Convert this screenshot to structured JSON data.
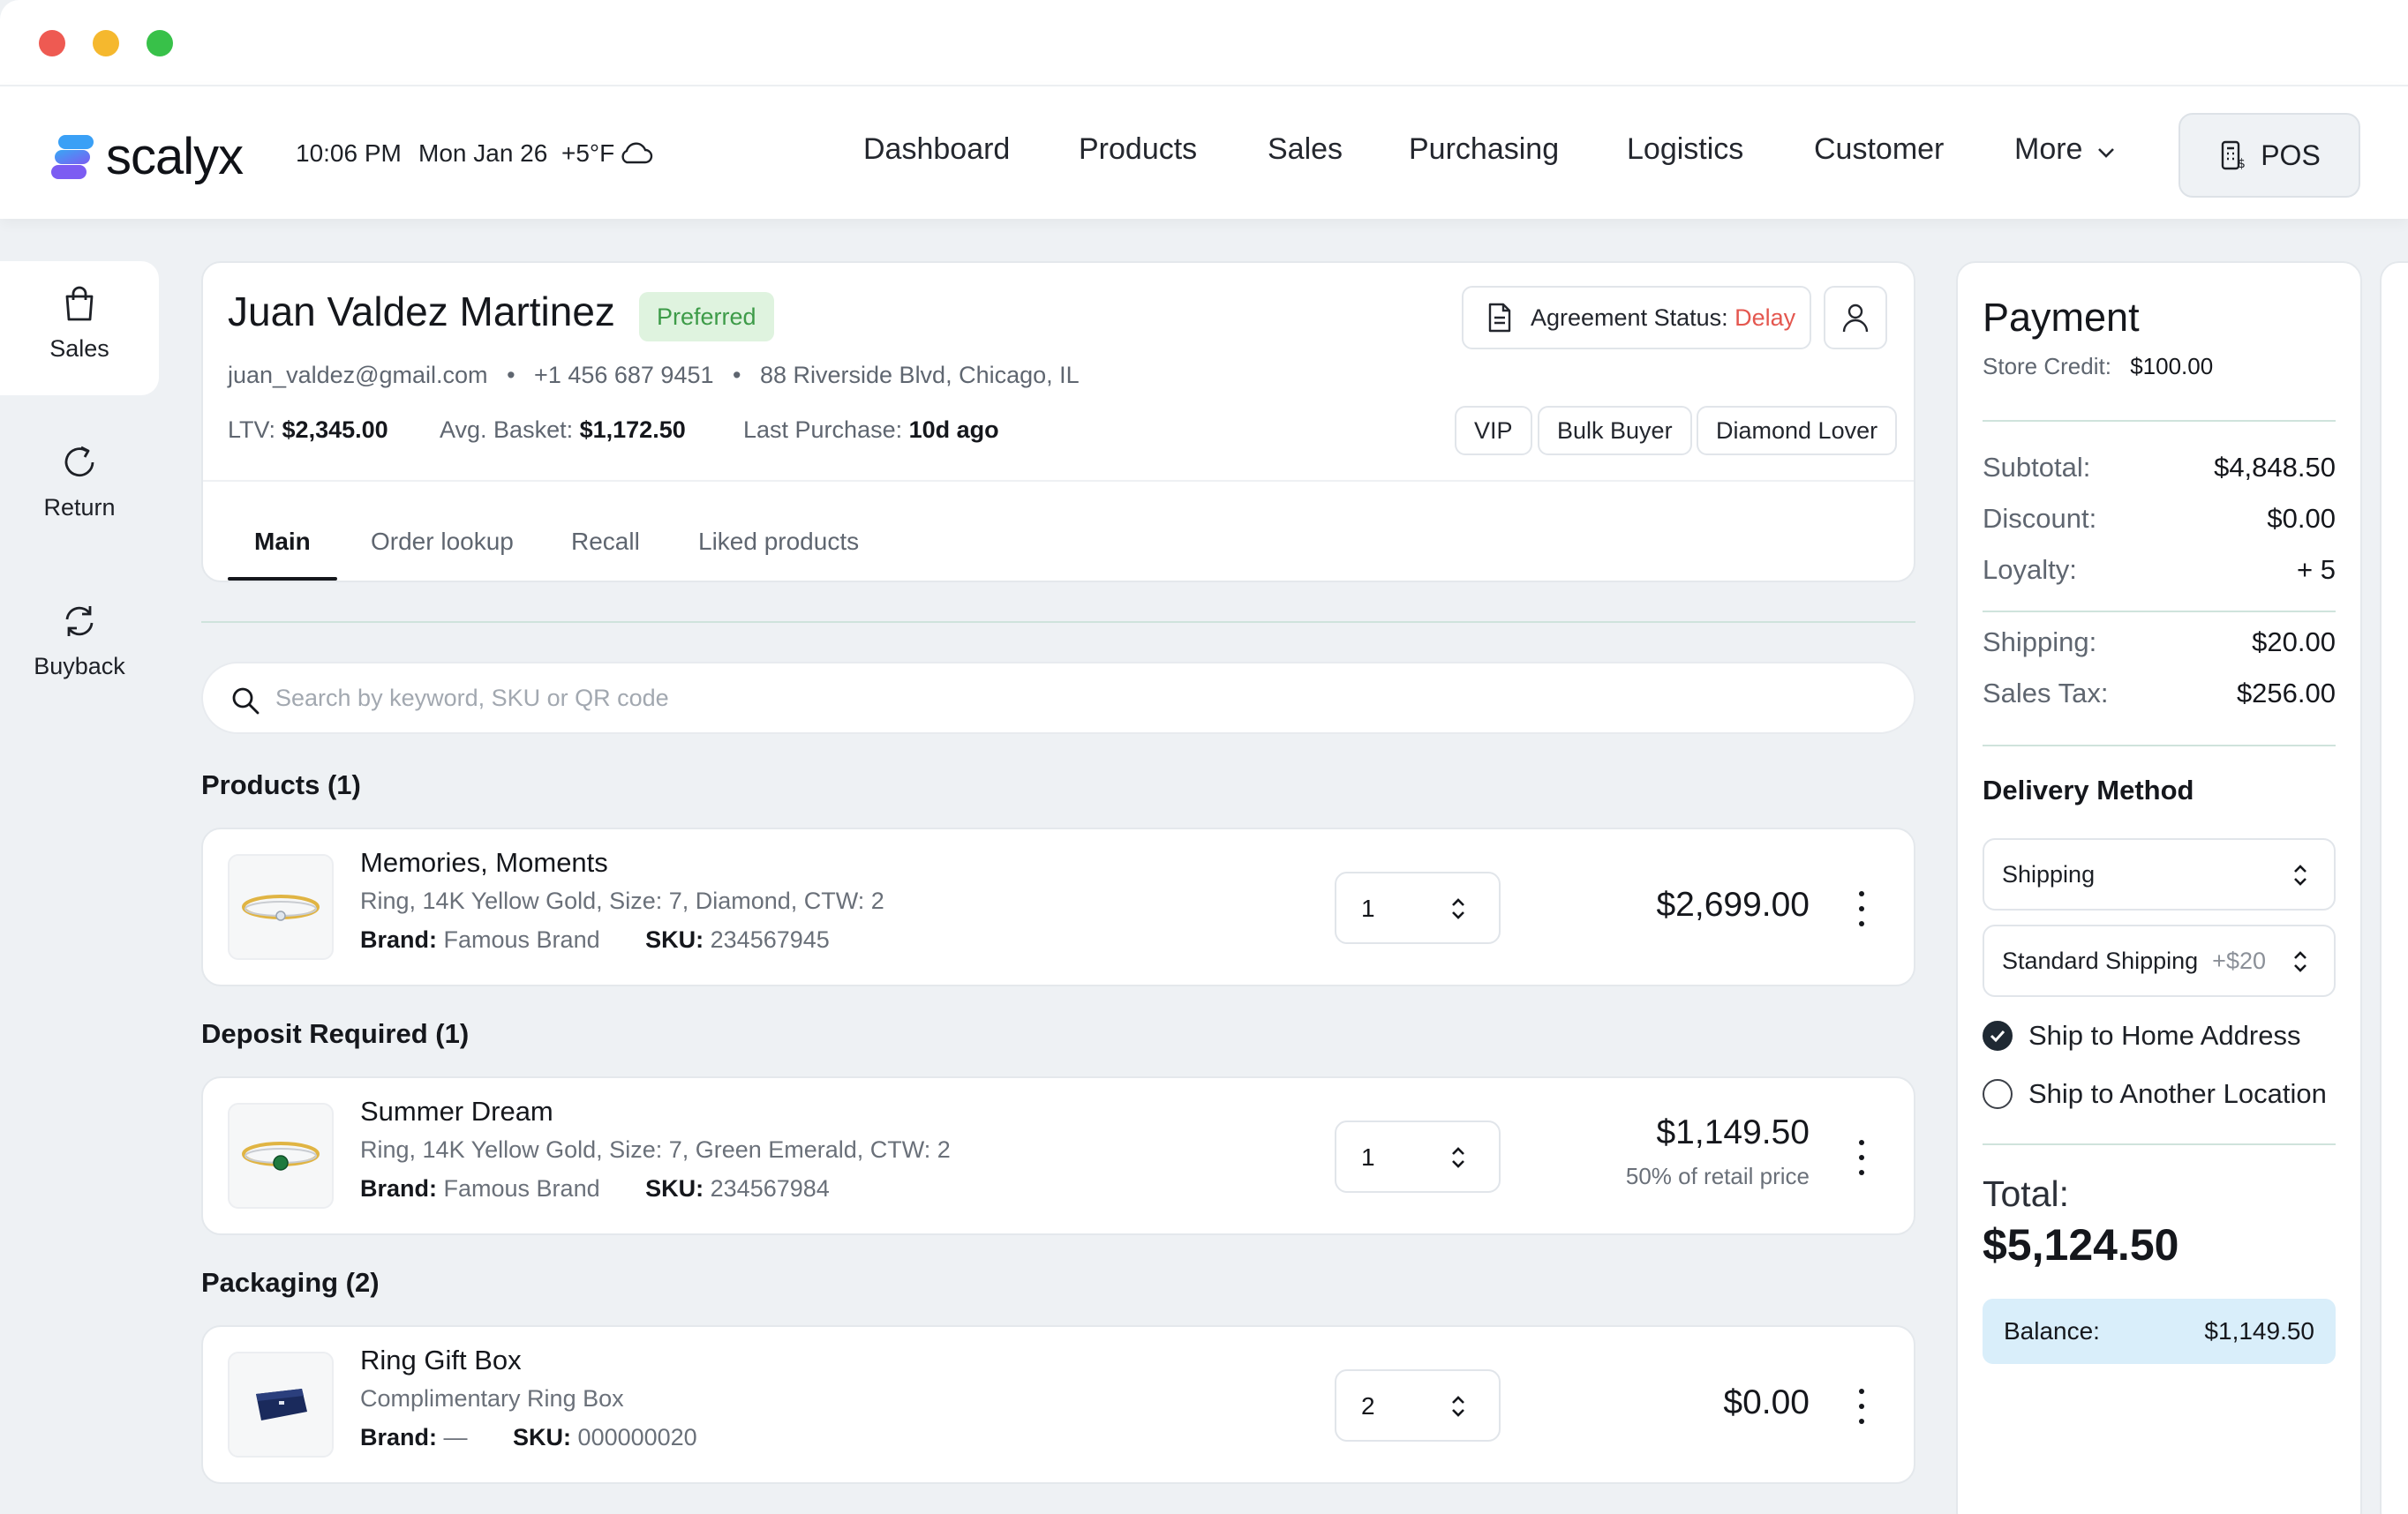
{
  "header": {
    "brand": "scalyx",
    "time": "10:06 PM",
    "date": "Mon Jan 26",
    "weather": "+5°F",
    "weather_icon": "cloud-icon",
    "nav": [
      "Dashboard",
      "Products",
      "Sales",
      "Purchasing",
      "Logistics",
      "Customer",
      "More"
    ],
    "pos_label": "POS"
  },
  "sidebar": {
    "items": [
      {
        "label": "Sales",
        "icon": "shopping-bag-icon",
        "active": true
      },
      {
        "label": "Return",
        "icon": "rotate-icon",
        "active": false
      },
      {
        "label": "Buyback",
        "icon": "refresh-icon",
        "active": false
      }
    ]
  },
  "customer": {
    "name": "Juan Valdez Martinez",
    "badge": "Preferred",
    "email": "juan_valdez@gmail.com",
    "phone": "+1 456 687 9451",
    "address": "88 Riverside Blvd, Chicago, IL",
    "separator": "•",
    "ltv_label": "LTV:",
    "ltv": "$2,345.00",
    "basket_label": "Avg. Basket:",
    "basket": "$1,172.50",
    "last_label": "Last Purchase:",
    "last": "10d ago",
    "agreement_label": "Agreement Status:",
    "agreement_status": "Delay",
    "tags": [
      "VIP",
      "Bulk Buyer",
      "Diamond Lover"
    ]
  },
  "tabs": [
    "Main",
    "Order lookup",
    "Recall",
    "Liked products"
  ],
  "search": {
    "placeholder": "Search by keyword, SKU or QR code"
  },
  "sections": [
    {
      "title": "Products (1)",
      "item": {
        "name": "Memories, Moments",
        "desc": "Ring, 14K Yellow Gold, Size: 7, Diamond, CTW: 2",
        "brand_label": "Brand:",
        "brand": "Famous Brand",
        "sku_label": "SKU:",
        "sku": "234567945",
        "qty": "1",
        "price": "$2,699.00",
        "price_note": ""
      }
    },
    {
      "title": "Deposit Required (1)",
      "item": {
        "name": "Summer Dream",
        "desc": "Ring, 14K Yellow Gold, Size: 7, Green Emerald, CTW: 2",
        "brand_label": "Brand:",
        "brand": "Famous Brand",
        "sku_label": "SKU:",
        "sku": "234567984",
        "qty": "1",
        "price": "$1,149.50",
        "price_note": "50% of retail price"
      }
    },
    {
      "title": "Packaging (2)",
      "item": {
        "name": "Ring Gift Box",
        "desc": "Complimentary Ring Box",
        "brand_label": "Brand:",
        "brand": "—",
        "sku_label": "SKU:",
        "sku": "000000020",
        "qty": "2",
        "price": "$0.00",
        "price_note": ""
      }
    }
  ],
  "payment": {
    "title": "Payment",
    "credit_label": "Store Credit:",
    "credit": "$100.00",
    "rows": [
      {
        "label": "Subtotal:",
        "value": "$4,848.50"
      },
      {
        "label": "Discount:",
        "value": "$0.00"
      },
      {
        "label": "Loyalty:",
        "value": "+ 5"
      },
      {
        "label": "Shipping:",
        "value": "$20.00"
      },
      {
        "label": "Sales Tax:",
        "value": "$256.00"
      }
    ],
    "delivery_title": "Delivery Method",
    "delivery_method": "Shipping",
    "shipping_option": "Standard Shipping",
    "shipping_extra": "+$20",
    "radio_home": "Ship to Home Address",
    "radio_other": "Ship to Another Location",
    "total_label": "Total:",
    "total": "$5,124.50",
    "balance_label": "Balance:",
    "balance": "$1,149.50"
  },
  "colors": {
    "accent_blue": "#3b82f6",
    "accent_purple": "#7c5cf2",
    "delay_red": "#e4574f",
    "preferred_green": "#3d9b48"
  }
}
